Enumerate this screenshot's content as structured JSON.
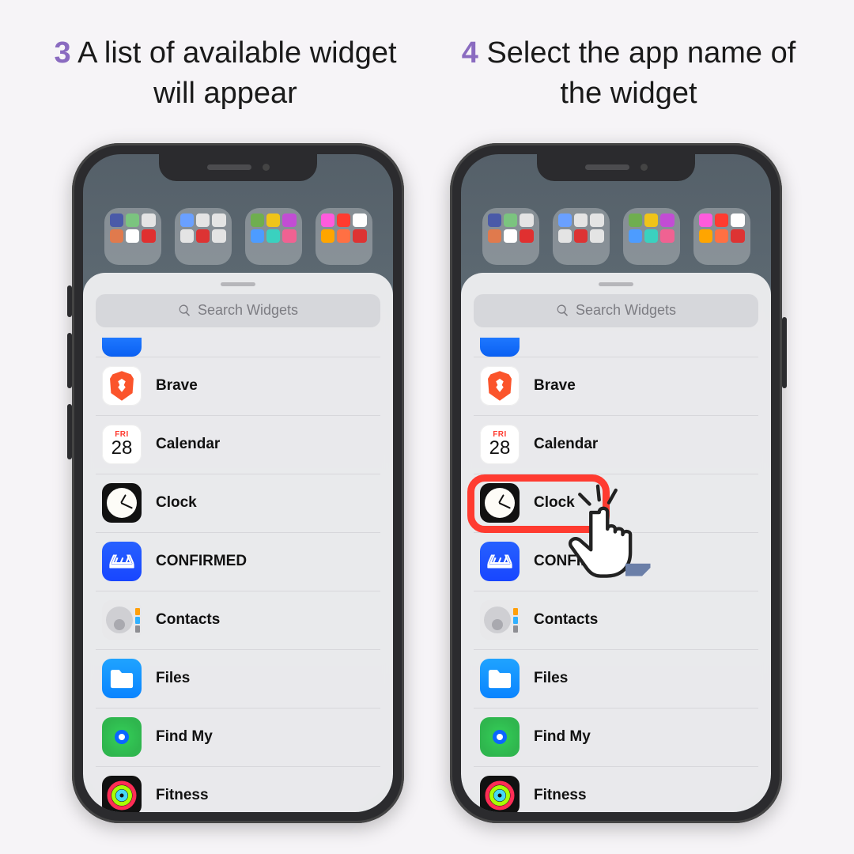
{
  "captions": {
    "step3": {
      "num": "3",
      "text": "A list of available widget will appear"
    },
    "step4": {
      "num": "4",
      "text": "Select the app name of the widget"
    }
  },
  "sheet": {
    "search_placeholder": "Search Widgets"
  },
  "calendar_icon": {
    "dow": "FRI",
    "day": "28"
  },
  "widget_list": [
    {
      "name": "Brave",
      "icon": "brave"
    },
    {
      "name": "Calendar",
      "icon": "calendar"
    },
    {
      "name": "Clock",
      "icon": "clock"
    },
    {
      "name": "CONFIRMED",
      "icon": "confirmed"
    },
    {
      "name": "Contacts",
      "icon": "contacts"
    },
    {
      "name": "Files",
      "icon": "files"
    },
    {
      "name": "Find My",
      "icon": "findmy"
    },
    {
      "name": "Fitness",
      "icon": "fitness"
    }
  ],
  "highlighted_app": "Clock"
}
